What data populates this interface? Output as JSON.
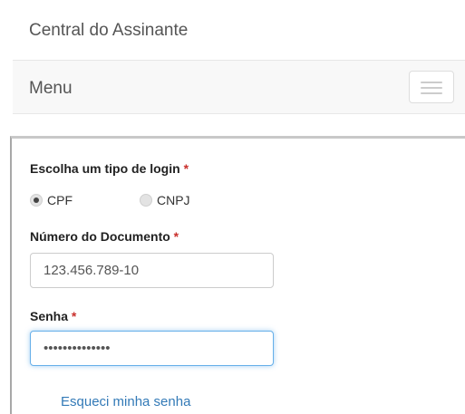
{
  "header": {
    "title": "Central do Assinante"
  },
  "navbar": {
    "menu_label": "Menu",
    "toggle_icon": "hamburger-icon"
  },
  "login_form": {
    "login_type": {
      "label": "Escolha um tipo de login",
      "required_marker": "*",
      "options": [
        {
          "label": "CPF",
          "selected": true
        },
        {
          "label": "CNPJ",
          "selected": false
        }
      ]
    },
    "document": {
      "label": "Número do Documento",
      "required_marker": "*",
      "value": "123.456.789-10"
    },
    "password": {
      "label": "Senha",
      "required_marker": "*",
      "value": "••••••••••••••"
    },
    "forgot_password": "Esqueci minha senha"
  },
  "colors": {
    "link": "#337ab7",
    "required": "#c9302c",
    "focus": "#66afe9"
  }
}
